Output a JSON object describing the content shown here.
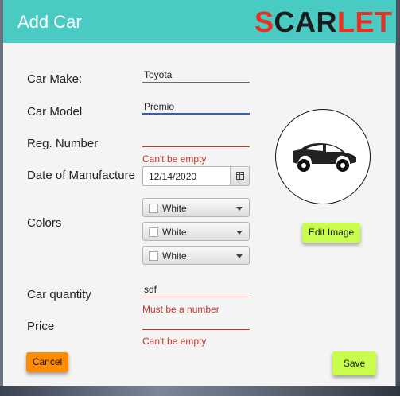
{
  "window": {
    "title": "Add Car",
    "logo": {
      "part1": "S",
      "part2": "CAR",
      "part3": "LET"
    }
  },
  "form": {
    "make": {
      "label": "Car Make:",
      "value": "Toyota"
    },
    "model": {
      "label": "Car Model",
      "value": "Premio"
    },
    "reg_number": {
      "label": "Reg. Number",
      "value": "",
      "error": "Can't be empty"
    },
    "date": {
      "label": "Date of Manufacture",
      "value": "12/14/2020",
      "icon": "calendar-icon"
    },
    "colors": {
      "label": "Colors",
      "options": [
        {
          "value": "White",
          "checked": false
        },
        {
          "value": "White",
          "checked": false
        },
        {
          "value": "White",
          "checked": false
        }
      ]
    },
    "quantity": {
      "label": "Car quantity",
      "value": "sdf",
      "error": "Must be a number"
    },
    "price": {
      "label": "Price",
      "value": "",
      "error": "Can't be empty"
    }
  },
  "image": {
    "icon": "car-icon",
    "edit_button": "Edit Image"
  },
  "actions": {
    "cancel": "Cancel",
    "save": "Save"
  },
  "colors": {
    "titlebar": "#49cbc3",
    "logo_red": "#e53223",
    "accent_green": "#c8fd4e",
    "cancel_orange": "#ff8c00",
    "error_red": "#c0392b"
  }
}
